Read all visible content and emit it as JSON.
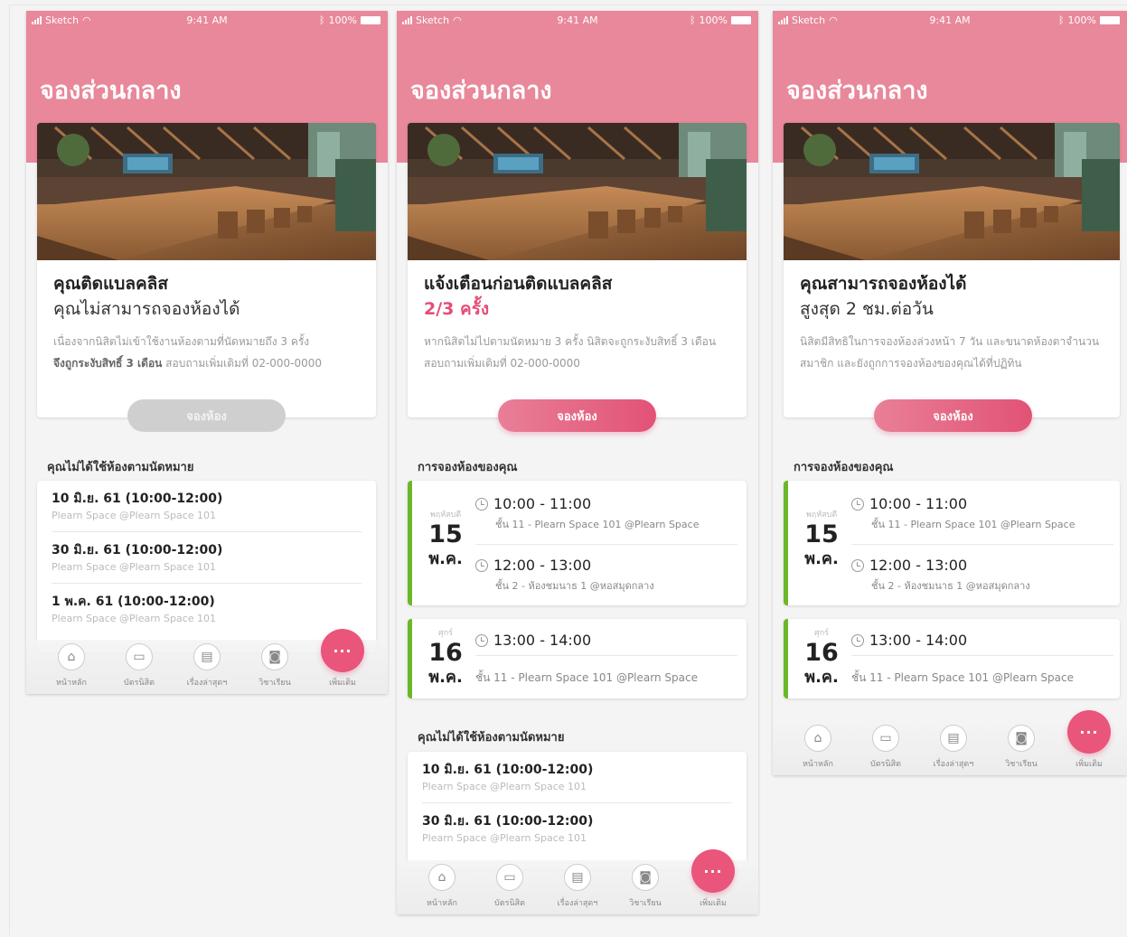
{
  "status": {
    "carrier": "Sketch",
    "time": "9:41 AM",
    "battery": "100%"
  },
  "page_title": "จองส่วนกลาง",
  "tabs": [
    {
      "label": "หน้าหลัก",
      "icon": "home-icon"
    },
    {
      "label": "บัตรนิสิต",
      "icon": "id-card-icon"
    },
    {
      "label": "เรื่องล่าสุดฯ",
      "icon": "document-icon"
    },
    {
      "label": "วิชาเรียน",
      "icon": "camera-icon"
    }
  ],
  "fab": {
    "symbol": "···",
    "label": "เพิ่มเติม"
  },
  "colors": {
    "pink": "#e8889a",
    "accent": "#e54d76",
    "green": "#6ab82a"
  },
  "screens": [
    {
      "headline1": "คุณติดแบลคลิส",
      "headline2": "คุณไม่สามารถจองห้องได้",
      "desc1": "เนื่องจากนิสิตไม่เข้าใช้งานห้องตามที่นัดหมายถึง 3 ครั้ง",
      "desc2_bold": "จึงถูกระงับสิทธิ์ 3 เดือน",
      "desc2_rest": " สอบถามเพิ่มเติมที่ 02-000-0000",
      "book_button": "จองห้อง",
      "missed_title": "คุณไม่ได้ใช้ห้องตามนัดหมาย",
      "missed": [
        {
          "date": "10 มิ.ย. 61  (10:00-12:00)",
          "location": "Plearn Space @Plearn Space 101"
        },
        {
          "date": "30 มิ.ย. 61 (10:00-12:00)",
          "location": "Plearn Space @Plearn Space 101"
        },
        {
          "date": "1 พ.ค. 61 (10:00-12:00)",
          "location": "Plearn Space @Plearn Space 101"
        }
      ]
    },
    {
      "headline1": "แจ้งเตือนก่อนติดแบลคลิส",
      "headline2": "2/3 ครั้ง",
      "desc1": "หากนิสิตไม่ไปตามนัดหมาย 3 ครั้ง นิสิตจะถูกระงับสิทธิ์ 3 เดือน",
      "desc2": "สอบถามเพิ่มเติมที่ 02-000-0000",
      "book_button": "จองห้อง",
      "bookings_title": "การจองห้องของคุณ",
      "bookings": [
        {
          "dow": "พฤหัสบดี",
          "day": "15",
          "month": "พ.ค.",
          "slots": [
            {
              "time": "10:00 - 11:00",
              "location": "ชั้น 11 - Plearn Space 101 @Plearn Space"
            },
            {
              "time": "12:00 - 13:00",
              "location": "ชั้น 2 - ห้องชมนาธ 1 @หอสมุดกลาง"
            }
          ]
        },
        {
          "dow": "ศุกร์",
          "day": "16",
          "month": "พ.ค.",
          "slots": [
            {
              "time": "13:00 - 14:00",
              "location": "ชั้น 11 - Plearn Space 101 @Plearn Space"
            }
          ]
        }
      ],
      "missed_title": "คุณไม่ได้ใช้ห้องตามนัดหมาย",
      "missed": [
        {
          "date": "10 มิ.ย. 61  (10:00-12:00)",
          "location": "Plearn Space @Plearn Space 101"
        },
        {
          "date": "30 มิ.ย. 61 (10:00-12:00)",
          "location": "Plearn Space @Plearn Space 101"
        }
      ]
    },
    {
      "headline1": "คุณสามารถจองห้องได้",
      "headline2": "สูงสุด 2 ชม.ต่อวัน",
      "desc1": "นิสิตมีสิทธิในการจองห้องล่วงหน้า 7 วัน และขนาดห้องตาจำนวน",
      "desc2": "สมาชิก และยังถูกการจองห้องของคุณได้ที่ปฏิทิน",
      "book_button": "จองห้อง",
      "bookings_title": "การจองห้องของคุณ",
      "bookings": [
        {
          "dow": "พฤหัสบดี",
          "day": "15",
          "month": "พ.ค.",
          "slots": [
            {
              "time": "10:00 - 11:00",
              "location": "ชั้น 11 - Plearn Space 101 @Plearn Space"
            },
            {
              "time": "12:00 - 13:00",
              "location": "ชั้น 2 - ห้องชมนาธ 1 @หอสมุดกลาง"
            }
          ]
        },
        {
          "dow": "ศุกร์",
          "day": "16",
          "month": "พ.ค.",
          "slots": [
            {
              "time": "13:00 - 14:00",
              "location": "ชั้น 11 - Plearn Space 101 @Plearn Space"
            }
          ]
        }
      ]
    }
  ]
}
